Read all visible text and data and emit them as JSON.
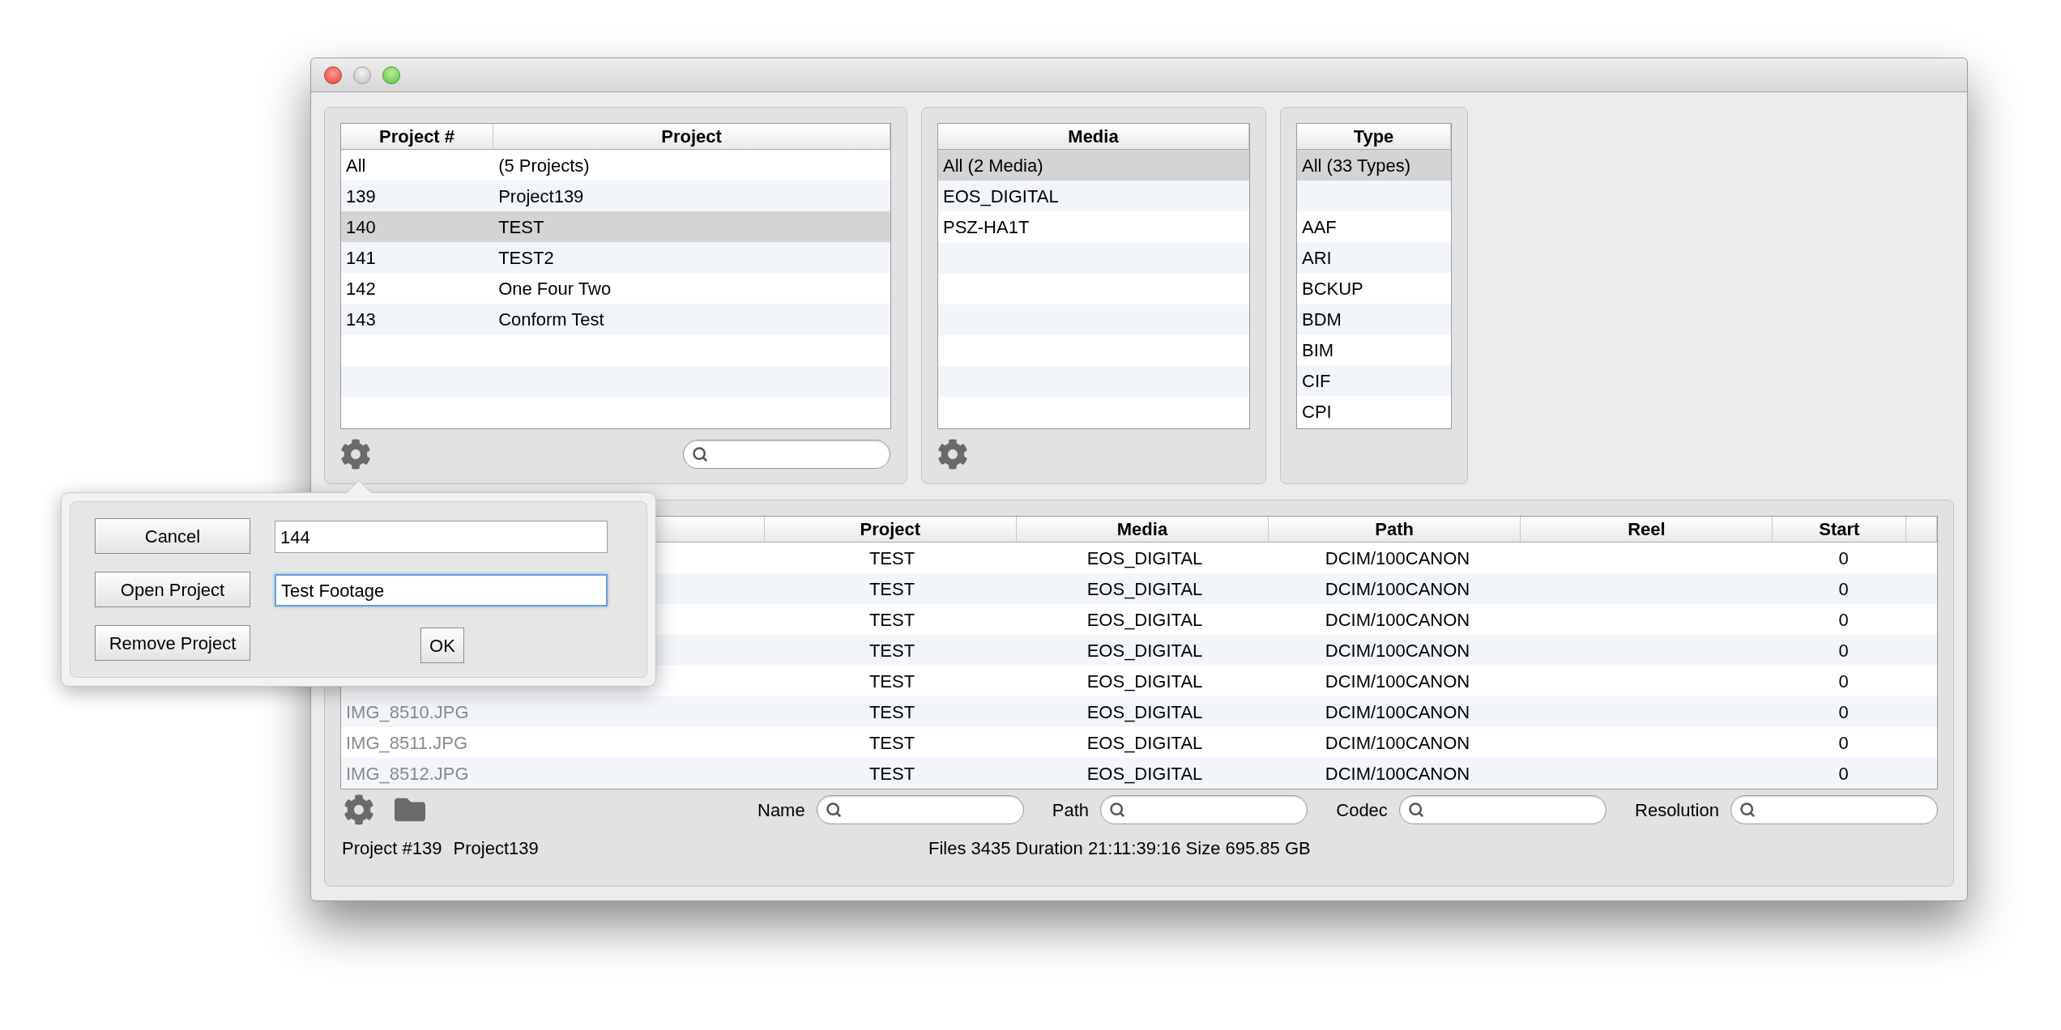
{
  "projects": {
    "columns": [
      "Project #",
      "Project"
    ],
    "rows": [
      {
        "cells": [
          "All",
          "(5 Projects)"
        ],
        "selected": false
      },
      {
        "cells": [
          "139",
          "Project139"
        ],
        "selected": false
      },
      {
        "cells": [
          "140",
          "TEST"
        ],
        "selected": true
      },
      {
        "cells": [
          "141",
          "TEST2"
        ],
        "selected": false
      },
      {
        "cells": [
          "142",
          "One Four Two"
        ],
        "selected": false
      },
      {
        "cells": [
          "143",
          "Conform Test"
        ],
        "selected": false
      }
    ]
  },
  "media": {
    "columns": [
      "Media"
    ],
    "rows": [
      {
        "cells": [
          "All (2 Media)"
        ],
        "selected": true
      },
      {
        "cells": [
          "EOS_DIGITAL"
        ],
        "selected": false
      },
      {
        "cells": [
          "PSZ-HA1T"
        ],
        "selected": false
      }
    ]
  },
  "types": {
    "columns": [
      "Type"
    ],
    "rows": [
      {
        "cells": [
          "All (33 Types)"
        ],
        "selected": true
      },
      {
        "cells": [],
        "selected": false
      },
      {
        "cells": [
          "AAF"
        ],
        "selected": false
      },
      {
        "cells": [
          "ARI"
        ],
        "selected": false
      },
      {
        "cells": [
          "BCKUP"
        ],
        "selected": false
      },
      {
        "cells": [
          "BDM"
        ],
        "selected": false
      },
      {
        "cells": [
          "BIM"
        ],
        "selected": false
      },
      {
        "cells": [
          "CIF"
        ],
        "selected": false
      },
      {
        "cells": [
          "CPI"
        ],
        "selected": false
      }
    ]
  },
  "files": {
    "columns": [
      "Project",
      "Media",
      "Path",
      "Reel",
      "Start"
    ],
    "rows": [
      {
        "project": "TEST",
        "media": "EOS_DIGITAL",
        "path": "DCIM/100CANON",
        "start": "0"
      },
      {
        "project": "TEST",
        "media": "EOS_DIGITAL",
        "path": "DCIM/100CANON",
        "start": "0"
      },
      {
        "project": "TEST",
        "media": "EOS_DIGITAL",
        "path": "DCIM/100CANON",
        "start": "0"
      },
      {
        "project": "TEST",
        "media": "EOS_DIGITAL",
        "path": "DCIM/100CANON",
        "start": "0"
      },
      {
        "project": "TEST",
        "media": "EOS_DIGITAL",
        "path": "DCIM/100CANON",
        "start": "0"
      },
      {
        "name": "IMG_8510.JPG",
        "project": "TEST",
        "media": "EOS_DIGITAL",
        "path": "DCIM/100CANON",
        "start": "0"
      },
      {
        "name": "IMG_8511.JPG",
        "project": "TEST",
        "media": "EOS_DIGITAL",
        "path": "DCIM/100CANON",
        "start": "0"
      },
      {
        "name": "IMG_8512.JPG",
        "project": "TEST",
        "media": "EOS_DIGITAL",
        "path": "DCIM/100CANON",
        "start": "0"
      }
    ]
  },
  "filters": [
    {
      "label": "Name"
    },
    {
      "label": "Path"
    },
    {
      "label": "Codec"
    },
    {
      "label": "Resolution"
    }
  ],
  "status": {
    "project_number": "Project #139",
    "project_name": "Project139",
    "summary": "Files 3435 Duration 21:11:39:16 Size 695.85 GB"
  },
  "popover": {
    "buttons": [
      "Cancel",
      "Open Project",
      "Remove Project"
    ],
    "fields": [
      {
        "value": "144",
        "focused": false
      },
      {
        "value": "Test Footage",
        "focused": true
      }
    ],
    "confirm": "OK"
  }
}
